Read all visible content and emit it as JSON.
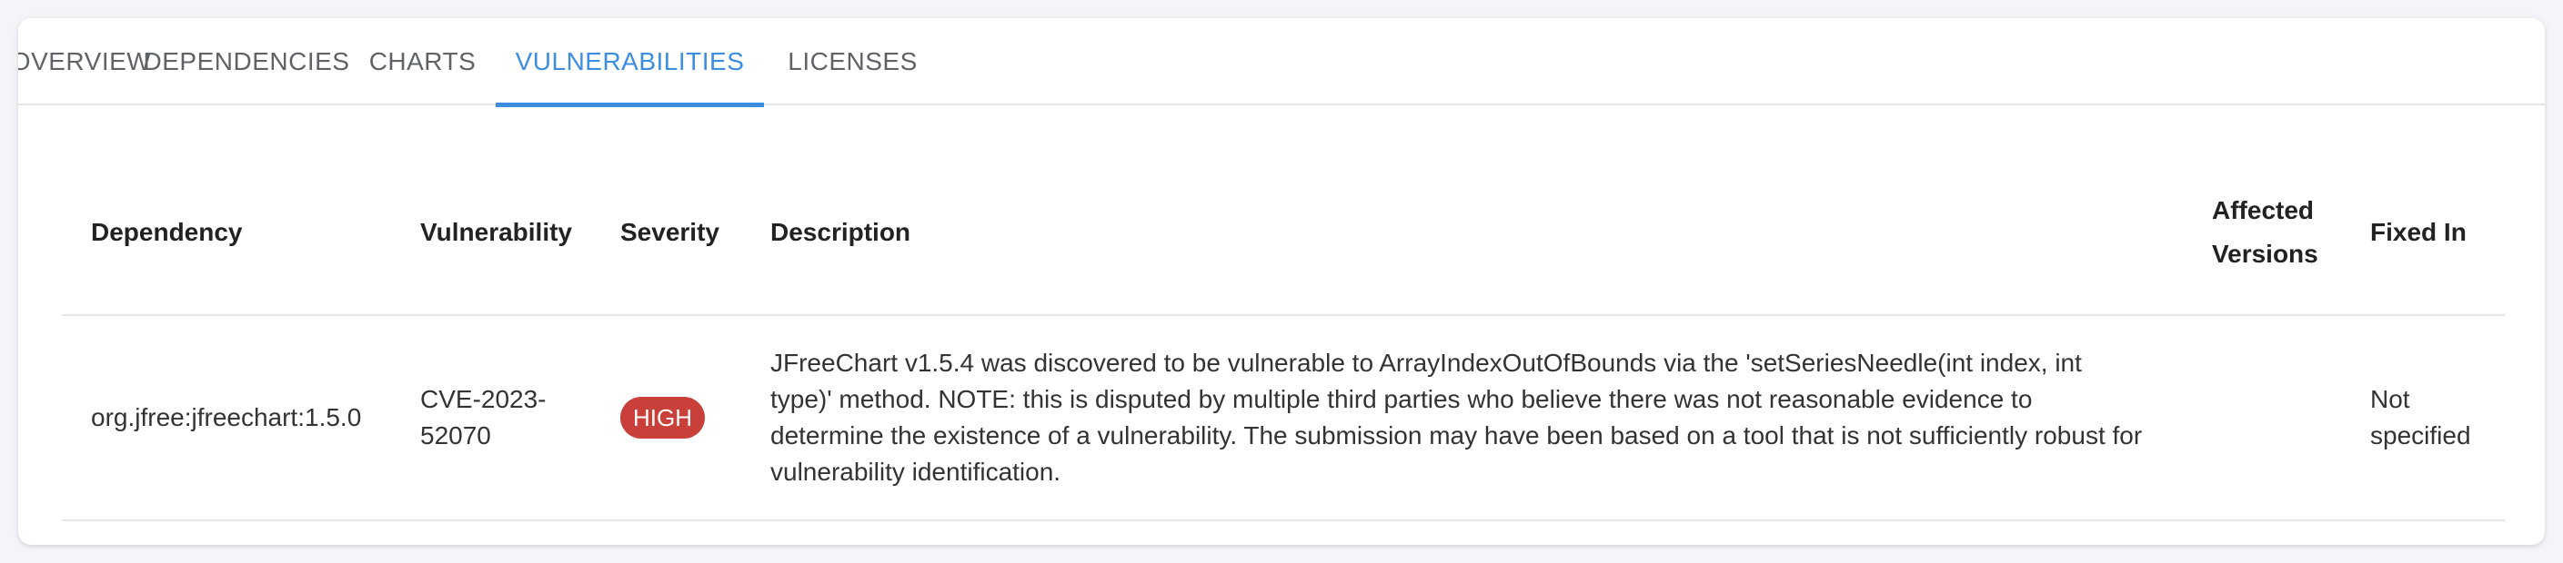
{
  "tabs": [
    {
      "label": "OVERVIEW"
    },
    {
      "label": "DEPENDENCIES"
    },
    {
      "label": "CHARTS"
    },
    {
      "label": "VULNERABILITIES"
    },
    {
      "label": "LICENSES"
    }
  ],
  "active_tab": "VULNERABILITIES",
  "table": {
    "headers": {
      "dependency": "Dependency",
      "vulnerability": "Vulnerability",
      "severity": "Severity",
      "description": "Description",
      "affected_versions": "Affected Versions",
      "fixed_in": "Fixed In"
    },
    "rows": [
      {
        "dependency": "org.jfree:jfreechart:1.5.0",
        "vulnerability": "CVE-2023-52070",
        "severity": "HIGH",
        "description": "JFreeChart v1.5.4 was discovered to be vulnerable to ArrayIndexOutOfBounds via the 'setSeriesNeedle(int index, int type)' method. NOTE: this is disputed by multiple third parties who believe there was not reasonable evidence to determine the existence of a vulnerability. The submission may have been based on a tool that is not sufficiently robust for vulnerability identification.",
        "affected_versions": "",
        "fixed_in": "Not specified"
      }
    ]
  },
  "colors": {
    "accent": "#3d8de0",
    "severity_high": "#c9403a",
    "background": "#f4f5f9"
  }
}
